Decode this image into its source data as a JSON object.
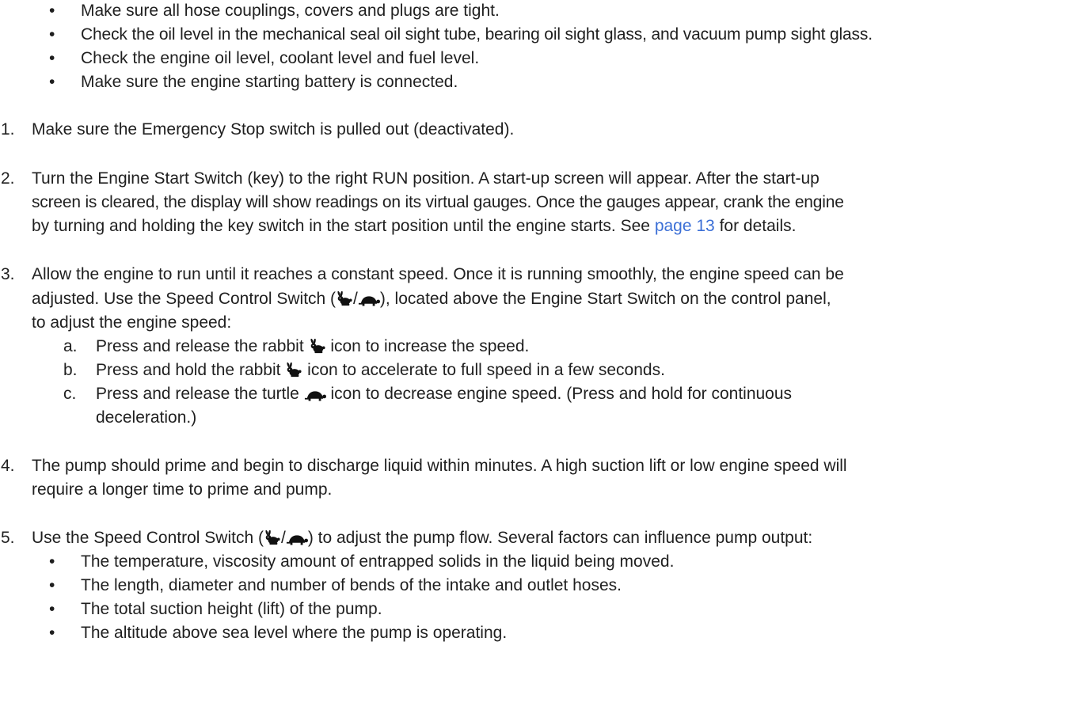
{
  "top_bullets": [
    "Make sure all hose couplings, covers and plugs are tight.",
    "Check the oil level in the mechanical seal oil sight tube, bearing oil sight glass, and vacuum pump sight glass.",
    "Check the engine oil level, coolant level and fuel level.",
    "Make sure the engine starting battery is connected."
  ],
  "bullet_glyph": "•",
  "steps": {
    "s1": {
      "num": "1.",
      "line1": "Make sure the Emergency Stop switch is pulled out (deactivated)."
    },
    "s2": {
      "num": "2.",
      "line1": "Turn the Engine Start Switch (key) to the right RUN position. A start-up screen will appear. After the start-up",
      "line2": "screen is cleared, the display will show readings on its virtual gauges. Once the gauges appear, crank the engine",
      "line3_pre": "by turning and holding the key switch in the start position until the engine starts. See ",
      "line3_link": "page 13",
      "line3_post": " for details."
    },
    "s3": {
      "num": "3.",
      "line1": "Allow the engine to run until it reaches a constant speed. Once it is running smoothly, the engine speed can be",
      "line2_pre": "adjusted. Use the Speed Control Switch (",
      "line2_slash": "/",
      "line2_post": "), located above the Engine Start Switch on the control panel,",
      "line3": "to adjust the engine speed:",
      "sub": {
        "a": {
          "letter": "a.",
          "pre": "Press and release the rabbit ",
          "post": " icon to increase the speed."
        },
        "b": {
          "letter": "b.",
          "pre": "Press and hold the rabbit ",
          "post": " icon to accelerate to full speed in a few seconds."
        },
        "c": {
          "letter": "c.",
          "pre": "Press and release the turtle ",
          "post": " icon to decrease engine speed. (Press and hold for continuous",
          "line2": "deceleration.)"
        }
      }
    },
    "s4": {
      "num": "4.",
      "line1": "The pump should prime and begin to discharge liquid within minutes. A high suction lift or low engine speed will",
      "line2": "require a longer time to prime and pump."
    },
    "s5": {
      "num": "5.",
      "line1_pre": "Use the Speed Control Switch (",
      "line1_slash": "/",
      "line1_post": ") to adjust the pump flow. Several factors can influence pump output:"
    }
  },
  "bottom_bullets": [
    "The temperature, viscosity amount of entrapped solids in the liquid being moved.",
    "The length, diameter and number of bends of the intake and outlet hoses.",
    "The total suction height (lift) of the pump.",
    "The altitude above sea level where the pump is operating."
  ],
  "icons": {
    "rabbit": "rabbit-icon",
    "turtle": "turtle-icon"
  }
}
